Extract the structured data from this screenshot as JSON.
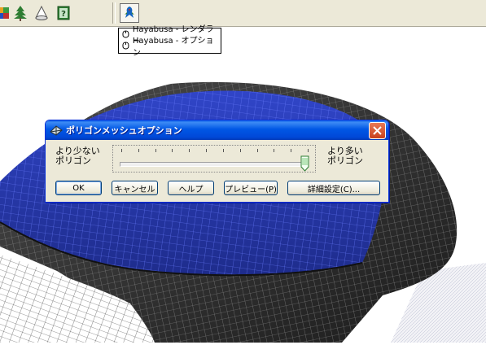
{
  "toolbar": {
    "icons": [
      "color-palette-icon",
      "tree-icon",
      "cone-shape-icon",
      "help-question-icon",
      "hayabusa-bird-icon"
    ]
  },
  "popup": {
    "items": [
      {
        "label": "Hayabusa - レンダラー"
      },
      {
        "label": "Hayabusa - オプション"
      }
    ]
  },
  "dialog": {
    "title": "ポリゴンメッシュオプション",
    "left_label": "より少ない\nポリゴン",
    "right_label": "より多い\nポリゴン",
    "slider_value_fraction": 0.98,
    "slider_ticks": 12,
    "buttons": {
      "ok": "OK",
      "cancel": "キャンセル",
      "help": "ヘルプ",
      "preview": "プレビュー(P)",
      "advanced": "詳細設定(C)..."
    }
  },
  "colors": {
    "xp_titlebar": "#0054e3",
    "dialog_face": "#ece9d8",
    "mesh_blue": "#2f43b8",
    "mesh_dark": "#2a2a2a"
  }
}
